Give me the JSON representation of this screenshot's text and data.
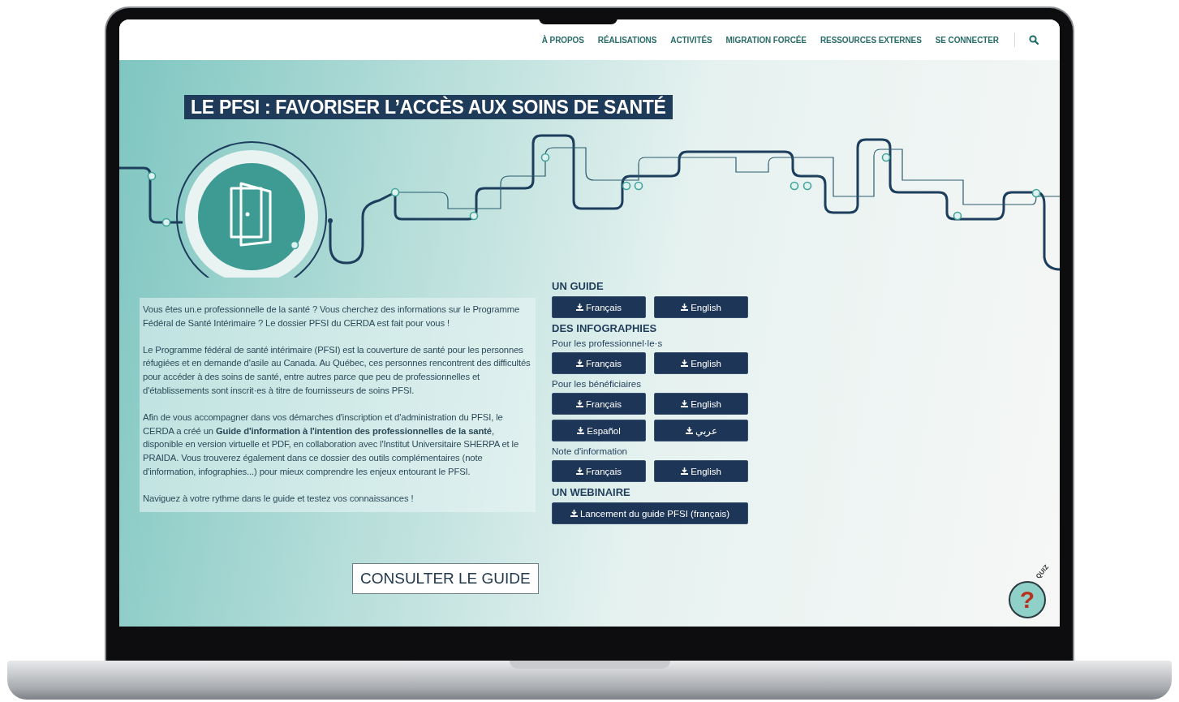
{
  "nav": {
    "items": [
      "À PROPOS",
      "RÉALISATIONS",
      "ACTIVITÉS",
      "MIGRATION FORCÉE",
      "RESSOURCES EXTERNES",
      "SE CONNECTER"
    ]
  },
  "title": "LE PFSI : FAVORISER L’ACCÈS AUX SOINS DE SANTÉ",
  "intro": [
    "Vous êtes un.e professionnelle de la santé ? Vous cherchez des informations sur le Programme Fédéral de Santé Intérimaire ? Le dossier PFSI du CERDA est fait pour vous !",
    "Le Programme fédéral de santé intérimaire (PFSI) est la couverture de santé pour les personnes réfugiées et en demande d'asile au Canada. Au Québec, ces personnes rencontrent des difficultés pour accéder à des soins de santé, entre autres parce que peu de professionnelles et d'établissements sont inscrit·es à titre de fournisseurs de soins PFSI.",
    "Afin de vous accompagner dans vos démarches d'inscription et d'administration du PFSI, le CERDA a créé un **Guide d'information à l'intention des professionnelles de la santé**, disponible en version virtuelle et PDF, en collaboration avec l'Institut Universitaire SHERPA et le PRAIDA. Vous trouverez également dans ce dossier des outils complémentaires (note d'information, infographies...) pour mieux comprendre les enjeux entourant le PFSI.",
    "Naviguez à votre rythme dans le guide et testez vos connaissances !"
  ],
  "downloads": [
    {
      "heading": "UN GUIDE",
      "groups": [
        {
          "buttons": [
            "Français",
            "English"
          ]
        }
      ]
    },
    {
      "heading": "DES INFOGRAPHIES",
      "groups": [
        {
          "label": "Pour les professionnel·le·s",
          "buttons": [
            "Français",
            "English"
          ]
        },
        {
          "label": "Pour les bénéficiaires",
          "buttons": [
            "Français",
            "English",
            "Español",
            "عربي"
          ]
        },
        {
          "label": "Note d'information",
          "buttons": [
            "Français",
            "English"
          ]
        }
      ]
    },
    {
      "heading": "UN WEBINAIRE",
      "groups": [
        {
          "wide": true,
          "buttons": [
            "Lancement du guide PFSI (français)"
          ]
        }
      ]
    }
  ],
  "guide_button": "CONSULTER LE GUIDE",
  "quiz": {
    "label": "QUIZ",
    "symbol": "?"
  }
}
